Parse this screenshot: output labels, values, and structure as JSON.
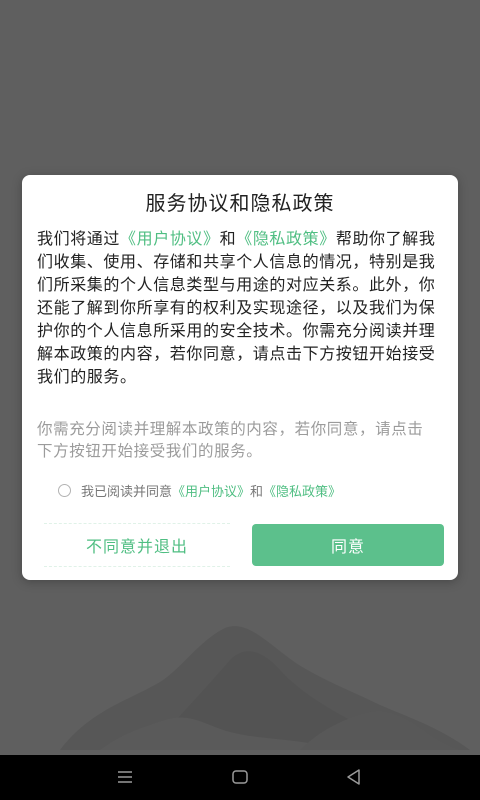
{
  "dialog": {
    "title": "服务协议和隐私政策",
    "intro_segments": [
      "我们将通过",
      "《用户协议》",
      "和",
      "《隐私政策》",
      "帮助你了解我们收集、使用、存储和共享个人信息的情况，特别是我们所采集的个人信息类型与用途的对应关系。此外，你还能了解到你所享有的权利及实现途径，以及我们为保护你的个人信息所采用的安全技术。你需充分阅读并理解本政策的内容，若你同意，请点击下方按钮开始接受我们的服务。"
    ],
    "notice": "你需充分阅读并理解本政策的内容，若你同意，请点击下方按钮开始接受我们的服务。",
    "consent": {
      "prefix": "我已阅读并同意",
      "user_agreement": "《用户协议》",
      "and": "和",
      "privacy_policy": "《隐私政策》"
    },
    "decline_label": "不同意并退出",
    "agree_label": "同意"
  },
  "colors": {
    "accent": "#4fbe82",
    "agree_button": "#5cc08c",
    "overlay": "#5f5f5f"
  },
  "nav": {
    "icons": [
      "menu-icon",
      "home-icon",
      "back-icon"
    ]
  }
}
